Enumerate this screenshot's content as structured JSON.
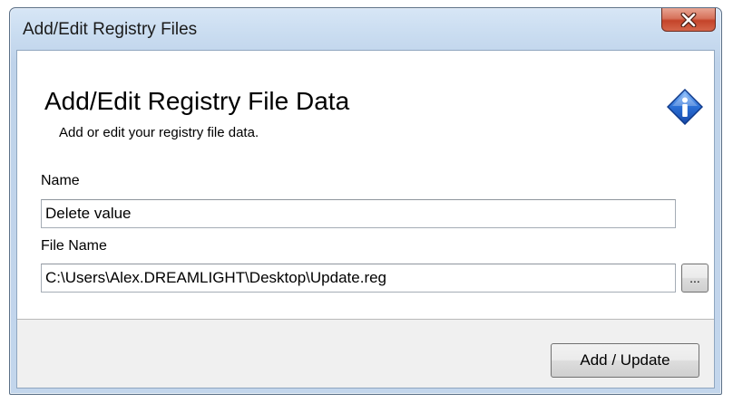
{
  "window": {
    "title": "Add/Edit Registry Files",
    "close_icon": "close-icon"
  },
  "header": {
    "title": "Add/Edit Registry File Data",
    "subtitle": "Add or edit your registry file data.",
    "icon": "info-icon"
  },
  "form": {
    "name_label": "Name",
    "name_value": "Delete value",
    "file_name_label": "File Name",
    "file_name_value": "C:\\Users\\Alex.DREAMLIGHT\\Desktop\\Update.reg",
    "browse_label": "..."
  },
  "footer": {
    "submit_label": "Add / Update"
  },
  "colors": {
    "close_button": "#c4442a",
    "info_icon": "#2a6fd6",
    "window_frame": "#c9dcf0"
  }
}
